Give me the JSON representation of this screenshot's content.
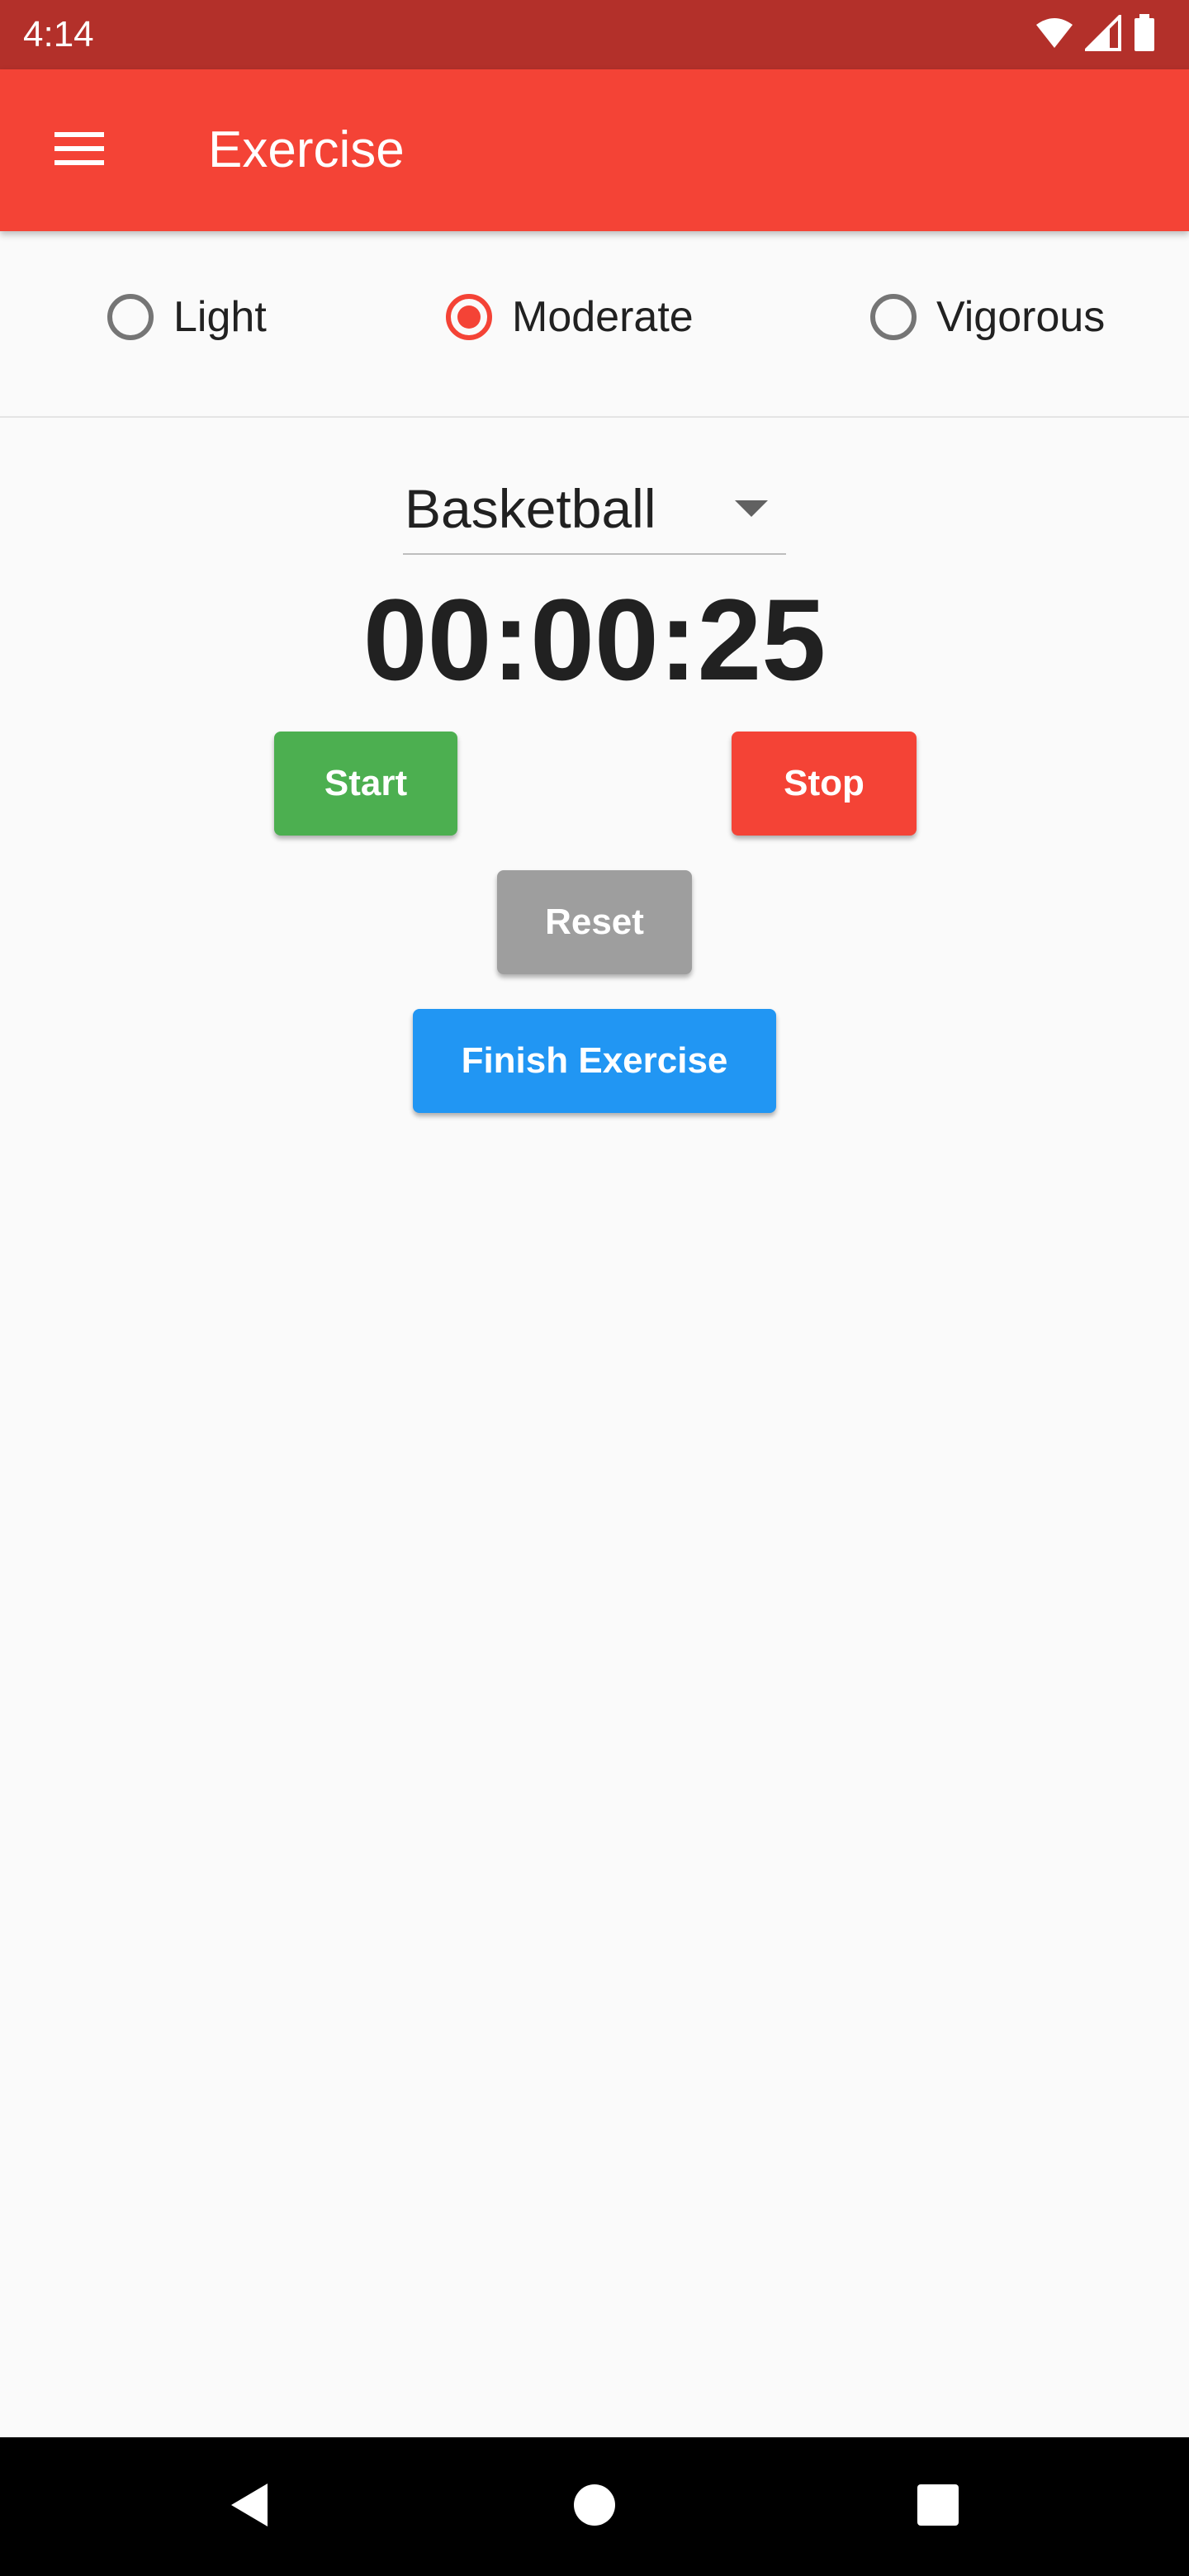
{
  "status_bar": {
    "time": "4:14",
    "icons": [
      "wifi-icon",
      "cellular-signal-icon",
      "battery-icon"
    ]
  },
  "app_bar": {
    "title": "Exercise",
    "menu_icon": "hamburger-menu-icon",
    "color": "#f44336"
  },
  "intensity": {
    "options": [
      {
        "label": "Light",
        "selected": false
      },
      {
        "label": "Moderate",
        "selected": true
      },
      {
        "label": "Vigorous",
        "selected": false
      }
    ],
    "accent": "#f44336"
  },
  "activity_dropdown": {
    "selected": "Basketball"
  },
  "timer": {
    "display": "00:00:25"
  },
  "buttons": {
    "start": {
      "label": "Start",
      "color": "#4caf50"
    },
    "stop": {
      "label": "Stop",
      "color": "#f44336"
    },
    "reset": {
      "label": "Reset",
      "color": "#9e9e9e"
    },
    "finish": {
      "label": "Finish Exercise",
      "color": "#2196f3"
    }
  },
  "nav_bar": {
    "icons": [
      "back-icon",
      "home-icon",
      "recents-icon"
    ]
  }
}
